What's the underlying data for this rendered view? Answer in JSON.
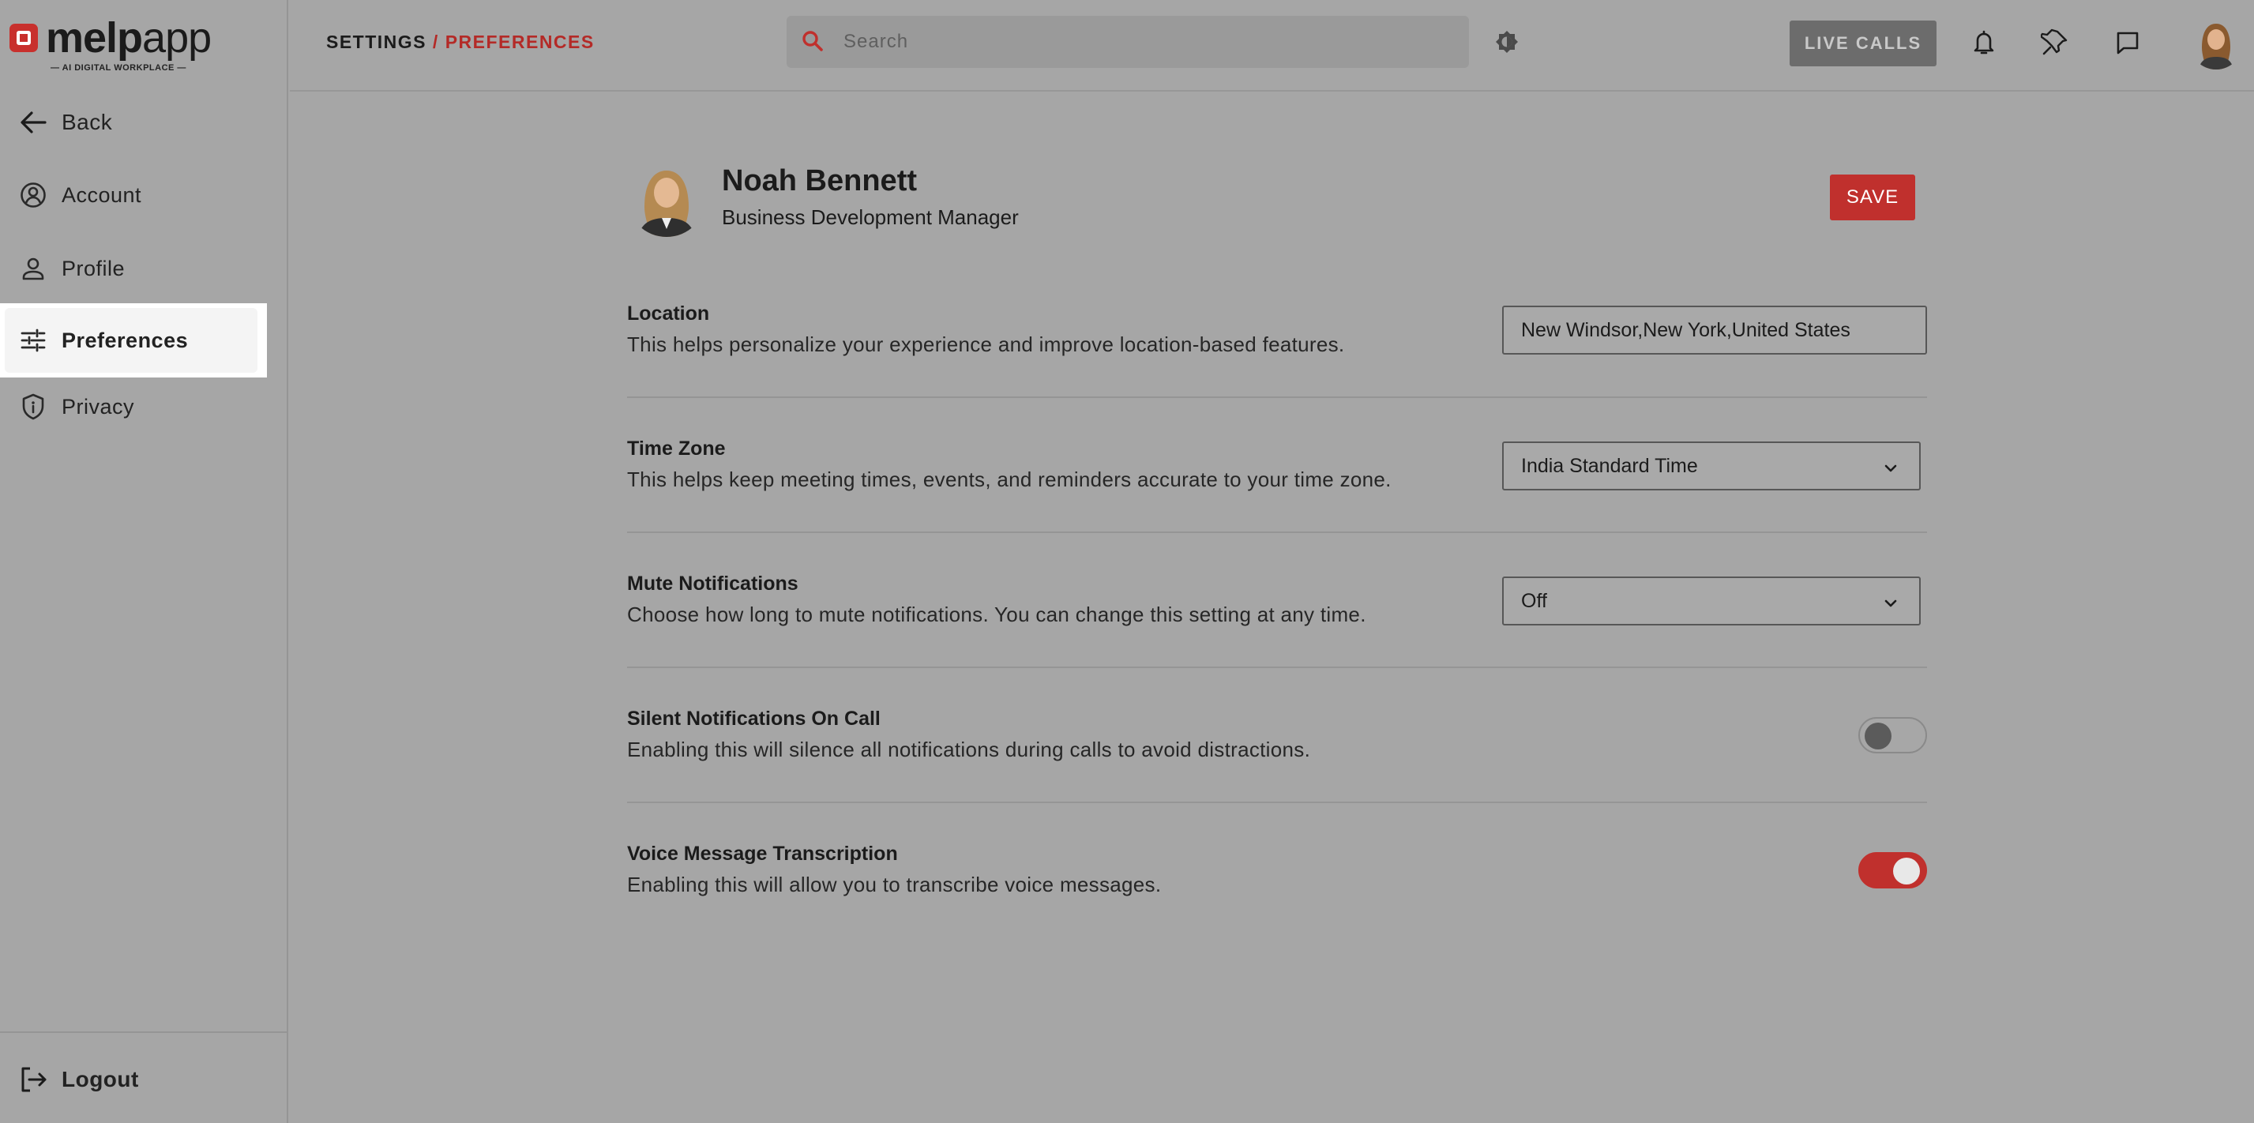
{
  "app": {
    "logo_main": "melp",
    "logo_rest": "app",
    "logo_tagline": "— AI DIGITAL WORKPLACE —"
  },
  "sidebar": {
    "back_label": "Back",
    "items": [
      {
        "label": "Account",
        "icon": "account-circle-icon"
      },
      {
        "label": "Profile",
        "icon": "person-icon"
      },
      {
        "label": "Preferences",
        "icon": "sliders-icon",
        "active": true
      },
      {
        "label": "Privacy",
        "icon": "shield-icon"
      }
    ],
    "logout_label": "Logout"
  },
  "header": {
    "breadcrumb_root": "SETTINGS",
    "breadcrumb_sep": "/",
    "breadcrumb_current": "PREFERENCES",
    "search_placeholder": "Search",
    "live_calls_label": "LIVE CALLS"
  },
  "profile": {
    "name": "Noah Bennett",
    "role": "Business Development Manager",
    "save_label": "SAVE"
  },
  "settings": {
    "location": {
      "title": "Location",
      "desc": "This helps personalize your experience and improve location-based features.",
      "value": "New Windsor,New York,United States"
    },
    "timezone": {
      "title": "Time Zone",
      "desc": "This helps keep meeting times, events, and reminders accurate to your time zone.",
      "value": "India Standard Time"
    },
    "mute": {
      "title": "Mute Notifications",
      "desc": "Choose how long to mute notifications. You can change this setting at any time.",
      "value": "Off"
    },
    "silent": {
      "title": "Silent Notifications On Call",
      "desc": "Enabling this will silence all notifications during calls to avoid distractions.",
      "enabled": false
    },
    "voice": {
      "title": "Voice Message Transcription",
      "desc": "Enabling this will allow you to transcribe voice messages.",
      "enabled": true
    }
  },
  "colors": {
    "accent": "#c0302d",
    "background": "#a6a6a6"
  }
}
